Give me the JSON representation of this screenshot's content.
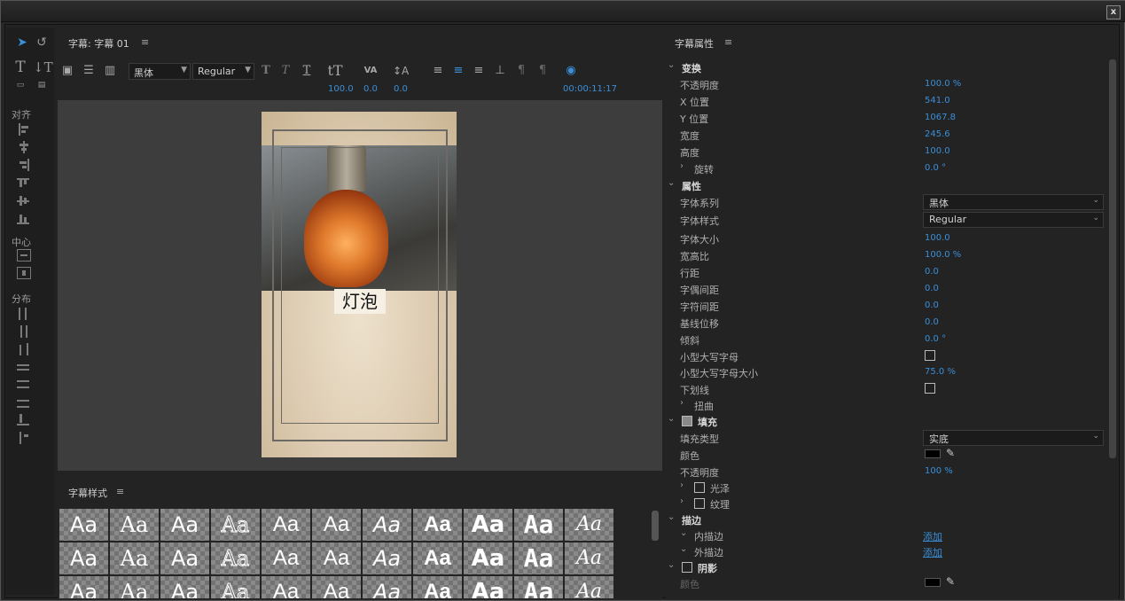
{
  "window": {
    "close": "x"
  },
  "tools": {
    "align_label": "对齐",
    "center_label": "中心",
    "distribute_label": "分布"
  },
  "title_panel": {
    "title": "字幕: 字幕 01",
    "menu": "≡",
    "font_family": "黑体",
    "font_style": "Regular",
    "font_size": "100.0",
    "kerning": "0.0",
    "leading": "0.0",
    "timecode": "00:00:11:17",
    "caption_text": "灯泡"
  },
  "styles_panel": {
    "title": "字幕样式",
    "menu": "≡",
    "swatch_label": "Aa"
  },
  "props": {
    "title": "字幕属性",
    "menu": "≡",
    "transform": {
      "label": "变换",
      "opacity_label": "不透明度",
      "opacity": "100.0 %",
      "x_label": "X 位置",
      "x": "541.0",
      "y_label": "Y 位置",
      "y": "1067.8",
      "width_label": "宽度",
      "width": "245.6",
      "height_label": "高度",
      "height": "100.0",
      "rotation_label": "旋转",
      "rotation": "0.0 °"
    },
    "properties": {
      "label": "属性",
      "font_family_label": "字体系列",
      "font_family": "黑体",
      "font_style_label": "字体样式",
      "font_style": "Regular",
      "font_size_label": "字体大小",
      "font_size": "100.0",
      "aspect_label": "宽高比",
      "aspect": "100.0 %",
      "leading_label": "行距",
      "leading": "0.0",
      "kerning_label": "字偶间距",
      "kerning": "0.0",
      "tracking_label": "字符间距",
      "tracking": "0.0",
      "baseline_label": "基线位移",
      "baseline": "0.0",
      "slant_label": "倾斜",
      "slant": "0.0 °",
      "smallcaps_label": "小型大写字母",
      "smallcaps_size_label": "小型大写字母大小",
      "smallcaps_size": "75.0 %",
      "underline_label": "下划线",
      "distort_label": "扭曲"
    },
    "fill": {
      "label": "填充",
      "type_label": "填充类型",
      "type": "实底",
      "color_label": "颜色",
      "color": "#000000",
      "opacity_label": "不透明度",
      "opacity": "100 %",
      "sheen_label": "光泽",
      "texture_label": "纹理"
    },
    "stroke": {
      "label": "描边",
      "inner_label": "内描边",
      "inner_add": "添加",
      "outer_label": "外描边",
      "outer_add": "添加"
    },
    "shadow": {
      "label": "阴影",
      "color_label": "颜色"
    }
  }
}
